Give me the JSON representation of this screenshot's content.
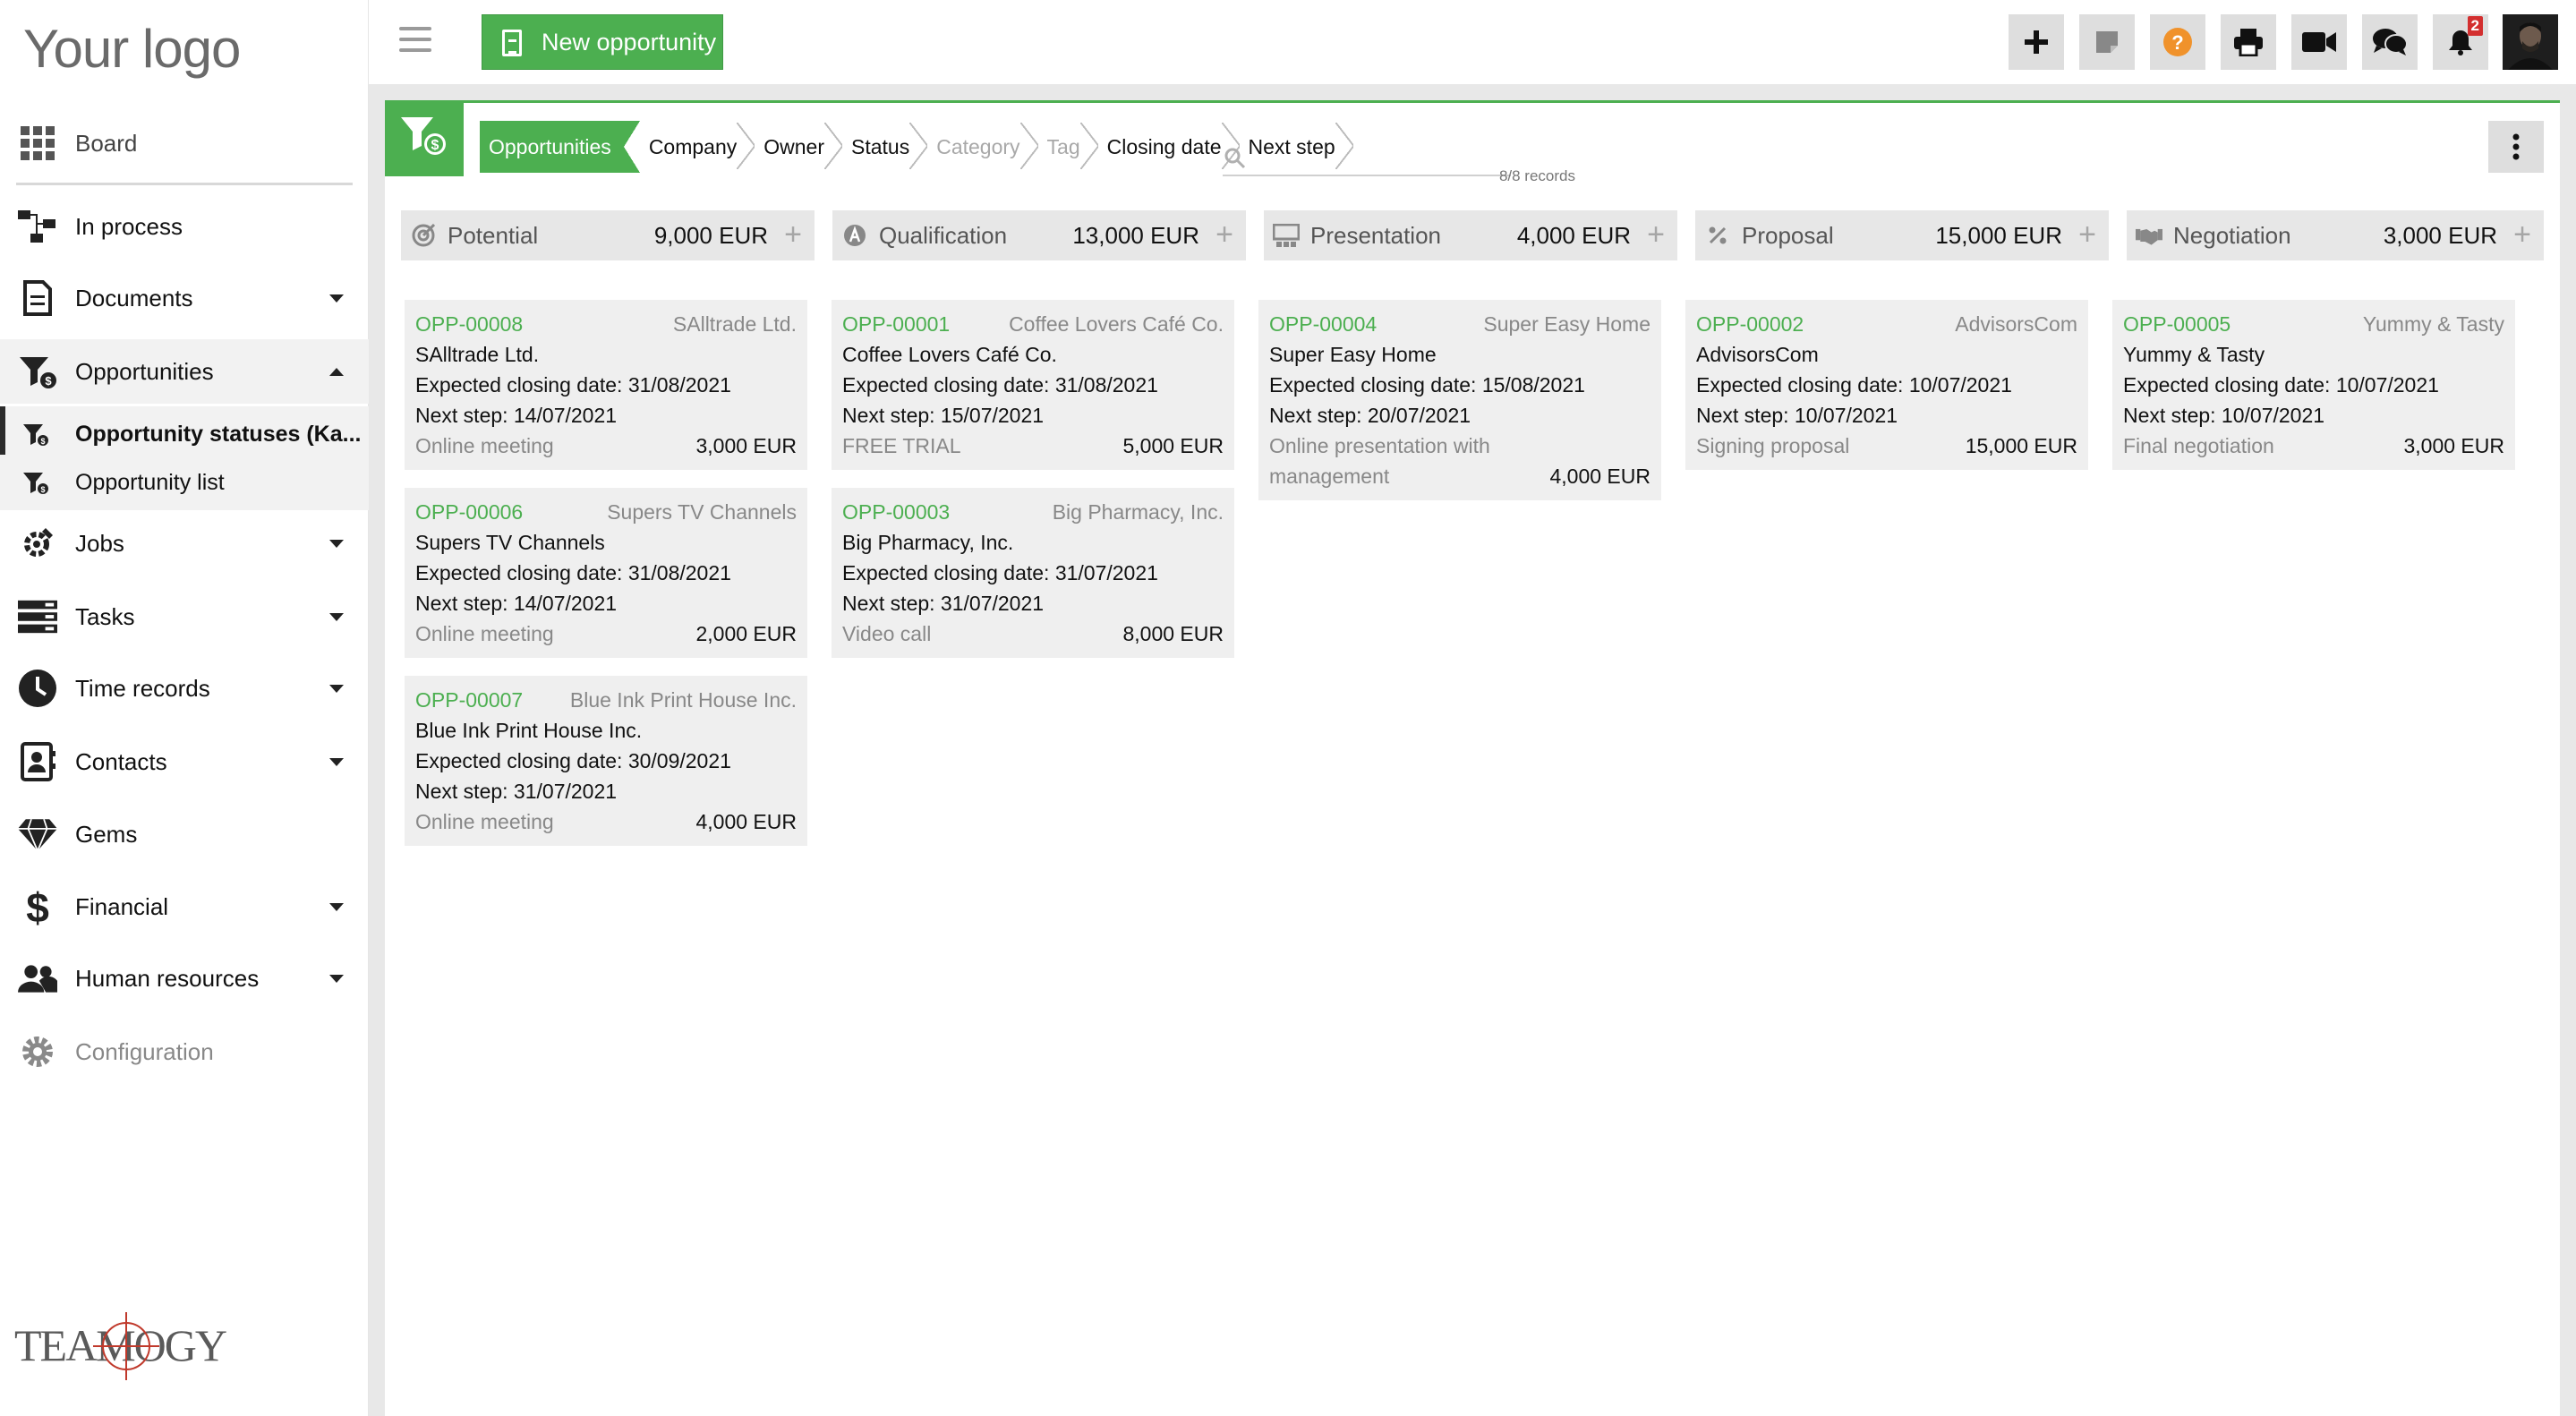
{
  "logo": "Your logo",
  "sidebar": {
    "items": [
      {
        "label": "Board"
      },
      {
        "label": "In process"
      },
      {
        "label": "Documents"
      },
      {
        "label": "Opportunities"
      },
      {
        "label": "Opportunity statuses (Ka..."
      },
      {
        "label": "Opportunity list"
      },
      {
        "label": "Jobs"
      },
      {
        "label": "Tasks"
      },
      {
        "label": "Time records"
      },
      {
        "label": "Contacts"
      },
      {
        "label": "Gems"
      },
      {
        "label": "Financial"
      },
      {
        "label": "Human resources"
      },
      {
        "label": "Configuration"
      }
    ],
    "brand": "TEAMOGY"
  },
  "topbar": {
    "new_button": "New opportunity",
    "buttons": [
      {
        "icon": "plus-icon"
      },
      {
        "icon": "sticky-note-icon"
      },
      {
        "icon": "help-icon",
        "color": "#f0922b"
      },
      {
        "icon": "print-icon"
      },
      {
        "icon": "video-icon"
      },
      {
        "icon": "chat-icon"
      },
      {
        "icon": "bell-icon",
        "badge": "2"
      }
    ]
  },
  "toolbar": {
    "breadcrumbs": [
      {
        "label": "Opportunities",
        "active": true
      },
      {
        "label": "Company"
      },
      {
        "label": "Owner"
      },
      {
        "label": "Status"
      },
      {
        "label": "Category",
        "disabled": true
      },
      {
        "label": "Tag",
        "disabled": true
      },
      {
        "label": "Closing date"
      },
      {
        "label": "Next step"
      }
    ],
    "search_placeholder": "",
    "records": "8/8 records"
  },
  "accent_color": "#4caf50",
  "columns": [
    {
      "title": "Potential",
      "amount": "9,000 EUR",
      "icon": "target-icon",
      "cards": [
        {
          "id": "OPP-00008",
          "company": "SAlltrade Ltd.",
          "name": "SAlltrade Ltd.",
          "closing": "Expected closing date: 31/08/2021",
          "next": "Next step: 14/07/2021",
          "step": "Online meeting",
          "amount": "3,000 EUR"
        },
        {
          "id": "OPP-00006",
          "company": "Supers TV Channels",
          "name": "Supers TV Channels",
          "closing": "Expected closing date: 31/08/2021",
          "next": "Next step: 14/07/2021",
          "step": "Online meeting",
          "amount": "2,000 EUR"
        },
        {
          "id": "OPP-00007",
          "company": "Blue Ink Print House Inc.",
          "name": "Blue Ink Print House Inc.",
          "closing": "Expected closing date: 30/09/2021",
          "next": "Next step: 31/07/2021",
          "step": "Online meeting",
          "amount": "4,000 EUR"
        }
      ]
    },
    {
      "title": "Qualification",
      "amount": "13,000 EUR",
      "icon": "qualification-icon",
      "cards": [
        {
          "id": "OPP-00001",
          "company": "Coffee Lovers Café Co.",
          "name": "Coffee Lovers Café Co.",
          "closing": "Expected closing date: 31/08/2021",
          "next": "Next step: 15/07/2021",
          "step": "FREE TRIAL",
          "amount": "5,000 EUR"
        },
        {
          "id": "OPP-00003",
          "company": "Big Pharmacy, Inc.",
          "name": "Big Pharmacy, Inc.",
          "closing": "Expected closing date: 31/07/2021",
          "next": "Next step: 31/07/2021",
          "step": "Video call",
          "amount": "8,000 EUR"
        }
      ]
    },
    {
      "title": "Presentation",
      "amount": "4,000 EUR",
      "icon": "presentation-icon",
      "cards": [
        {
          "id": "OPP-00004",
          "company": "Super Easy Home",
          "name": "Super Easy Home",
          "closing": "Expected closing date: 15/08/2021",
          "next": "Next step: 20/07/2021",
          "step": "Online presentation with management",
          "amount": "4,000 EUR"
        }
      ]
    },
    {
      "title": "Proposal",
      "amount": "15,000 EUR",
      "icon": "percent-icon",
      "cards": [
        {
          "id": "OPP-00002",
          "company": "AdvisorsCom",
          "name": "AdvisorsCom",
          "closing": "Expected closing date: 10/07/2021",
          "next": "Next step: 10/07/2021",
          "step": "Signing proposal",
          "amount": "15,000 EUR"
        }
      ]
    },
    {
      "title": "Negotiation",
      "amount": "3,000 EUR",
      "icon": "handshake-icon",
      "cards": [
        {
          "id": "OPP-00005",
          "company": "Yummy & Tasty",
          "name": "Yummy & Tasty",
          "closing": "Expected closing date: 10/07/2021",
          "next": "Next step: 10/07/2021",
          "step": "Final negotiation",
          "amount": "3,000 EUR"
        }
      ]
    }
  ]
}
